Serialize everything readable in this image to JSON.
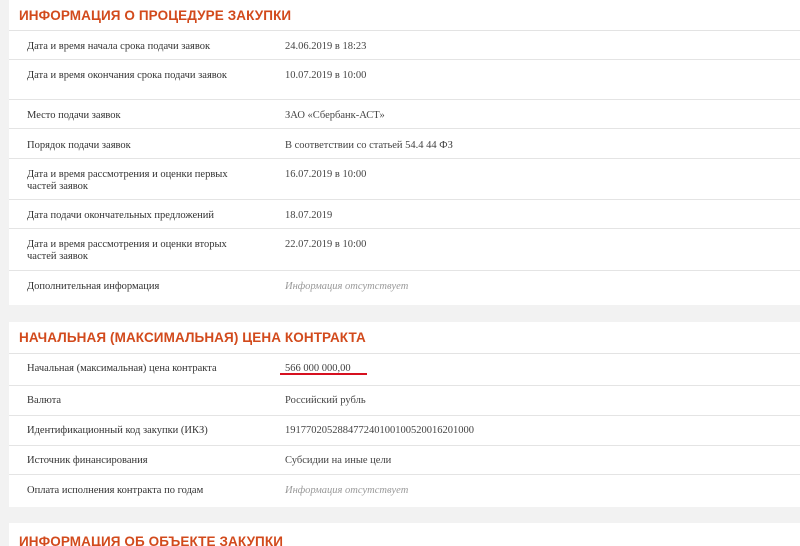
{
  "procedure": {
    "title": "ИНФОРМАЦИЯ О ПРОЦЕДУРЕ ЗАКУПКИ",
    "rows": [
      {
        "label": "Дата и время начала срока подачи заявок",
        "value": "24.06.2019 в 18:23"
      },
      {
        "label": "Дата и время окончания срока подачи заявок",
        "value": "10.07.2019 в 10:00"
      },
      {
        "label": "Место подачи заявок",
        "value": "ЗАО «Сбербанк-АСТ»"
      },
      {
        "label": "Порядок подачи заявок",
        "value": "В соответствии со статьей 54.4 44 ФЗ"
      },
      {
        "label": "Дата и время рассмотрения и оценки первых частей заявок",
        "value": "16.07.2019 в 10:00"
      },
      {
        "label": "Дата подачи окончательных предложений",
        "value": "18.07.2019"
      },
      {
        "label": "Дата и время рассмотрения и оценки вторых частей заявок",
        "value": "22.07.2019 в 10:00"
      },
      {
        "label": "Дополнительная информация",
        "value": "Информация отсутствует"
      }
    ]
  },
  "price": {
    "title": "НАЧАЛЬНАЯ (МАКСИМАЛЬНАЯ) ЦЕНА КОНТРАКТА",
    "rows": [
      {
        "label": "Начальная (максимальная) цена контракта",
        "value": "566 000 000,00"
      },
      {
        "label": "Валюта",
        "value": "Российский рубль"
      },
      {
        "label": "Идентификационный код закупки (ИКЗ)",
        "value": "191770205288477240100100520016201000"
      },
      {
        "label": "Источник финансирования",
        "value": "Субсидии на иные цели"
      },
      {
        "label": "Оплата исполнения контракта по годам",
        "value": "Информация отсутствует"
      }
    ]
  },
  "object": {
    "title": "ИНФОРМАЦИЯ ОБ ОБЪЕКТЕ ЗАКУПКИ"
  },
  "colors": {
    "accent": "#d24a1c",
    "underline": "#d6101f"
  }
}
